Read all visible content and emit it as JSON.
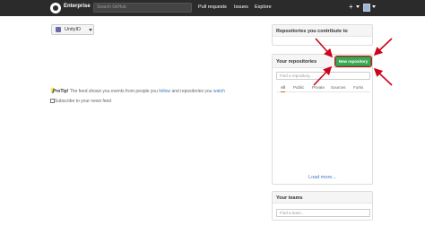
{
  "header": {
    "brand": "Enterprise",
    "search_placeholder": "Search GitHub",
    "nav": [
      "Pull requests",
      "Issues",
      "Explore"
    ],
    "plus": "+"
  },
  "context_switcher": {
    "label": "UnityID"
  },
  "feed": {
    "protip_label": "ProTip!",
    "protip_a": "The feed shows you events from people you",
    "follow_link": "follow",
    "protip_b": "and repositories you",
    "watch_link": "watch",
    "subscribe": "Subscribe to your news feed"
  },
  "contribute_panel": {
    "title": "Repositories you contribute to"
  },
  "repos_panel": {
    "title": "Your repositories",
    "new_button": "New repository",
    "find_placeholder": "Find a repository...",
    "filters": [
      "All",
      "Public",
      "Private",
      "Sources",
      "Forks"
    ],
    "load_more": "Load more..."
  },
  "teams_panel": {
    "title": "Your teams",
    "find_placeholder": "Find a team..."
  },
  "colors": {
    "topbar": "#2b2b2b",
    "new_button": "#3ba854",
    "annotation_arrow": "#d0021b",
    "link": "#4078c0"
  }
}
